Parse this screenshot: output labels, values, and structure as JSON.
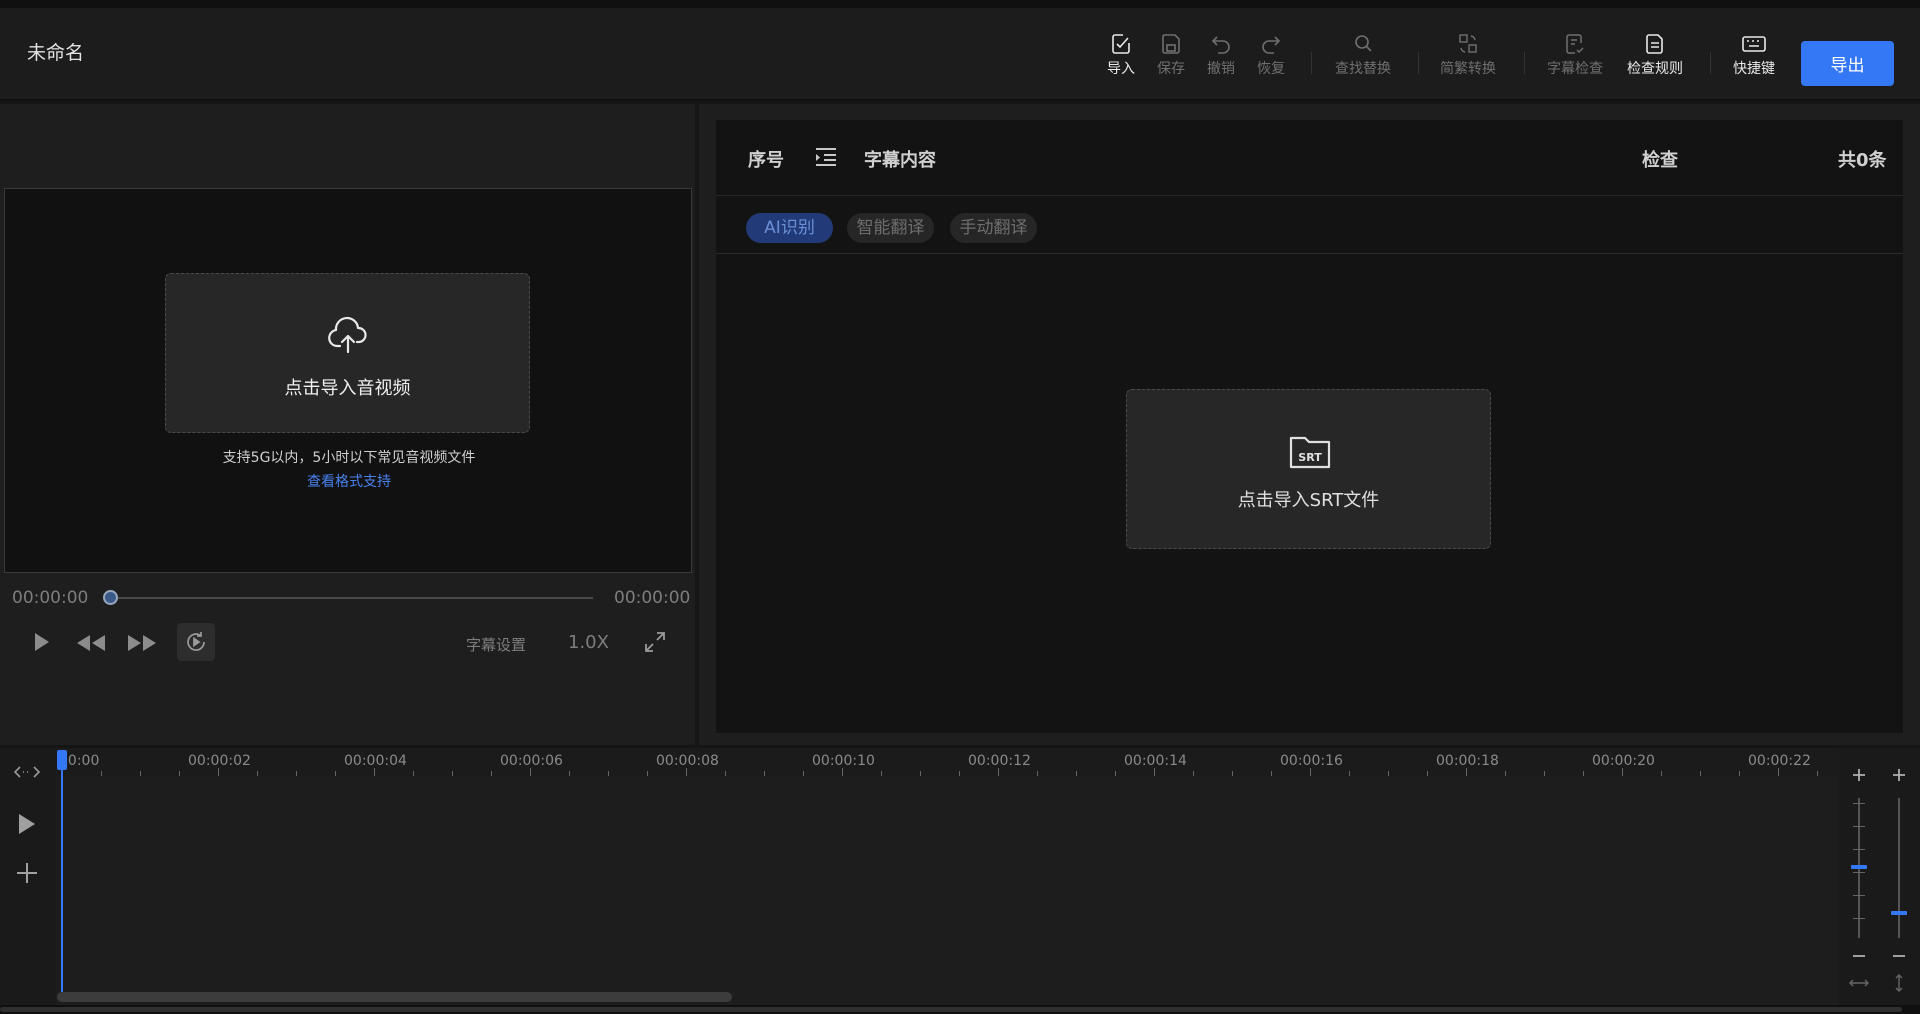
{
  "app": {
    "title": "未命名"
  },
  "toolbar": {
    "items": [
      {
        "label": "导入",
        "icon": "import-icon",
        "enabled": true
      },
      {
        "label": "保存",
        "icon": "save-icon",
        "enabled": false
      },
      {
        "label": "撤销",
        "icon": "undo-icon",
        "enabled": false
      },
      {
        "label": "恢复",
        "icon": "redo-icon",
        "enabled": false
      },
      {
        "label": "查找替换",
        "icon": "search-icon",
        "enabled": false
      },
      {
        "label": "简繁转换",
        "icon": "convert-icon",
        "enabled": false
      },
      {
        "label": "字幕检查",
        "icon": "subtitle-check-icon",
        "enabled": false
      },
      {
        "label": "检查规则",
        "icon": "rules-icon",
        "enabled": true
      },
      {
        "label": "快捷键",
        "icon": "keyboard-icon",
        "enabled": true
      }
    ],
    "export_label": "导出",
    "accent_color": "#3478f6"
  },
  "player": {
    "upload_label": "点击导入音视频",
    "upload_hint": "支持5G以内，5小时以下常见音视频文件",
    "format_link": "查看格式支持",
    "time_current": "00:00:00",
    "time_total": "00:00:00",
    "progress": 0,
    "subtitle_settings_label": "字幕设置",
    "speed": "1.0X"
  },
  "subtitle_list": {
    "col_index": "序号",
    "col_content": "字幕内容",
    "col_check": "检查",
    "count": "共0条",
    "tabs": [
      {
        "label": "AI识别",
        "active": true
      },
      {
        "label": "智能翻译",
        "active": false
      },
      {
        "label": "手动翻译",
        "active": false
      }
    ],
    "srt_icon_text": "SRT",
    "import_srt_label": "点击导入SRT文件"
  },
  "timeline": {
    "ticks": [
      "00:00",
      "00:00:02",
      "00:00:04",
      "00:00:06",
      "00:00:08",
      "00:00:10",
      "00:00:12",
      "00:00:14",
      "00:00:16",
      "00:00:18",
      "00:00:20",
      "00:00:22"
    ],
    "tool_icons": [
      "expand-icon",
      "play-icon",
      "add-icon"
    ],
    "horizontal_zoom_level": 0.55,
    "vertical_zoom_level": 0.2
  }
}
